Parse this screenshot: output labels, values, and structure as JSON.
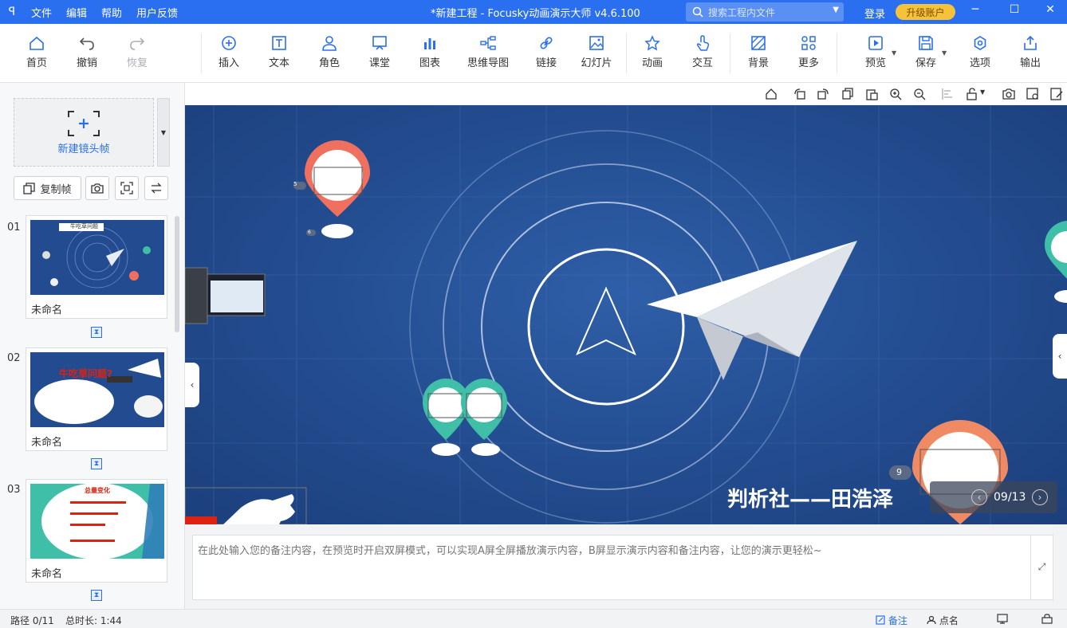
{
  "titlebar": {
    "logo": "ꟼ",
    "menu": [
      "文件",
      "编辑",
      "帮助",
      "用户反馈"
    ],
    "title": "*新建工程 - Focusky动画演示大师  v4.6.100",
    "search_placeholder": "搜索工程内文件",
    "login": "登录",
    "upgrade": "升级账户"
  },
  "ribbon": {
    "home": "首页",
    "undo": "撤销",
    "redo": "恢复",
    "insert": "插入",
    "text": "文本",
    "role": "角色",
    "class": "课堂",
    "chart": "图表",
    "mindmap": "思维导图",
    "link": "链接",
    "slideshow": "幻灯片",
    "animation": "动画",
    "interact": "交互",
    "background": "背景",
    "more": "更多",
    "preview": "预览",
    "save": "保存",
    "options": "选项",
    "export": "输出"
  },
  "leftpanel": {
    "new_frame": "新建镜头帧",
    "copy_frame": "复制帧",
    "slides": [
      {
        "num": "01",
        "name": "未命名",
        "thumb_title": "牛吃草问题"
      },
      {
        "num": "02",
        "name": "未命名",
        "thumb_title": "牛吃草问题?"
      },
      {
        "num": "03",
        "name": "未命名",
        "thumb_title": "总量变化"
      }
    ]
  },
  "canvas": {
    "slogan": "判析社——田浩泽",
    "pager": "09/13",
    "badge_9": "9",
    "pin_label_5": "5",
    "pin_label_6": "6"
  },
  "notes": {
    "placeholder": "在此处输入您的备注内容，在预览时开启双屏模式，可以实现A屏全屏播放演示内容，B屏显示演示内容和备注内容，让您的演示更轻松~"
  },
  "statusbar": {
    "path": "路径 0/11",
    "duration": "总时长: 1:44",
    "notes": "备注",
    "rollcall": "点名"
  },
  "colors": {
    "primary": "#2a6ff0",
    "upgrade": "#f6c23a",
    "stage_bg": "#244f93",
    "pin_red": "#f07060",
    "pin_teal": "#3fbfa8"
  }
}
